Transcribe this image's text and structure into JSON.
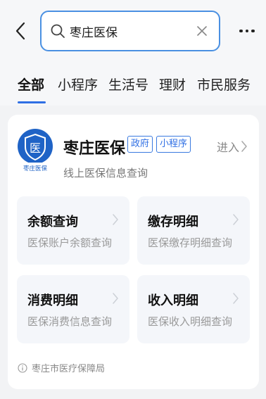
{
  "header": {
    "back_icon": "chevron-left-icon",
    "search_value": "枣庄医保",
    "search_icon": "search-icon",
    "clear_icon": "close-icon",
    "more_icon": "more-dots-icon"
  },
  "tabs": [
    {
      "label": "全部",
      "active": true
    },
    {
      "label": "小程序",
      "active": false
    },
    {
      "label": "生活号",
      "active": false
    },
    {
      "label": "理财",
      "active": false
    },
    {
      "label": "市民服务",
      "active": false
    }
  ],
  "result": {
    "logo_text": "枣庄医保",
    "logo_glyph": "医",
    "title": "枣庄医保",
    "tags": [
      "政府",
      "小程序"
    ],
    "enter_label": "进入",
    "subtitle": "线上医保信息查询",
    "tiles": [
      {
        "title": "余额查询",
        "desc": "医保账户余额查询"
      },
      {
        "title": "缴存明细",
        "desc": "医保缴存明细查询"
      },
      {
        "title": "消费明细",
        "desc": "医保消费信息查询"
      },
      {
        "title": "收入明细",
        "desc": "医保收入明细查询"
      }
    ],
    "footer": "枣庄市医疗保障局"
  },
  "colors": {
    "accent": "#2f6fe4",
    "logo_blue": "#1f63c6"
  }
}
